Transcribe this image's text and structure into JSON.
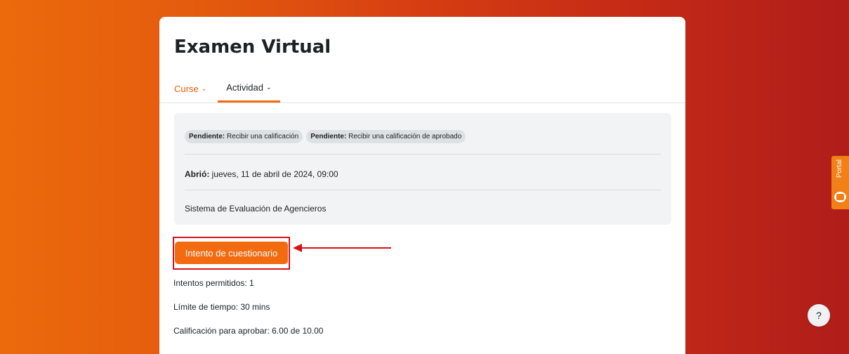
{
  "page": {
    "title": "Examen Virtual",
    "tabs": [
      {
        "label": "Curse"
      },
      {
        "label": "Actividad"
      }
    ]
  },
  "completion": {
    "badges": [
      {
        "status": "Pendiente:",
        "text": "Recibir una calificación"
      },
      {
        "status": "Pendiente:",
        "text": "Recibir una calificación de aprobado"
      }
    ]
  },
  "dates": {
    "opened_label": "Abrió:",
    "opened_value": "jueves, 11 de abril de 2024, 09:00"
  },
  "description": "Sistema de Evaluación de Agencieros",
  "actions": {
    "attempt_button": "Intento de cuestionario"
  },
  "quiz_info": {
    "attempts": "Intentos permitidos: 1",
    "time_limit": "Límite de tiempo: 30 mins",
    "pass_grade": "Calificación para aprobar: 6.00 de 10.00"
  },
  "widgets": {
    "portal_label": "Portal",
    "help_label": "?"
  },
  "colors": {
    "accent": "#f26b10",
    "highlight_annotation": "#d6121c"
  }
}
